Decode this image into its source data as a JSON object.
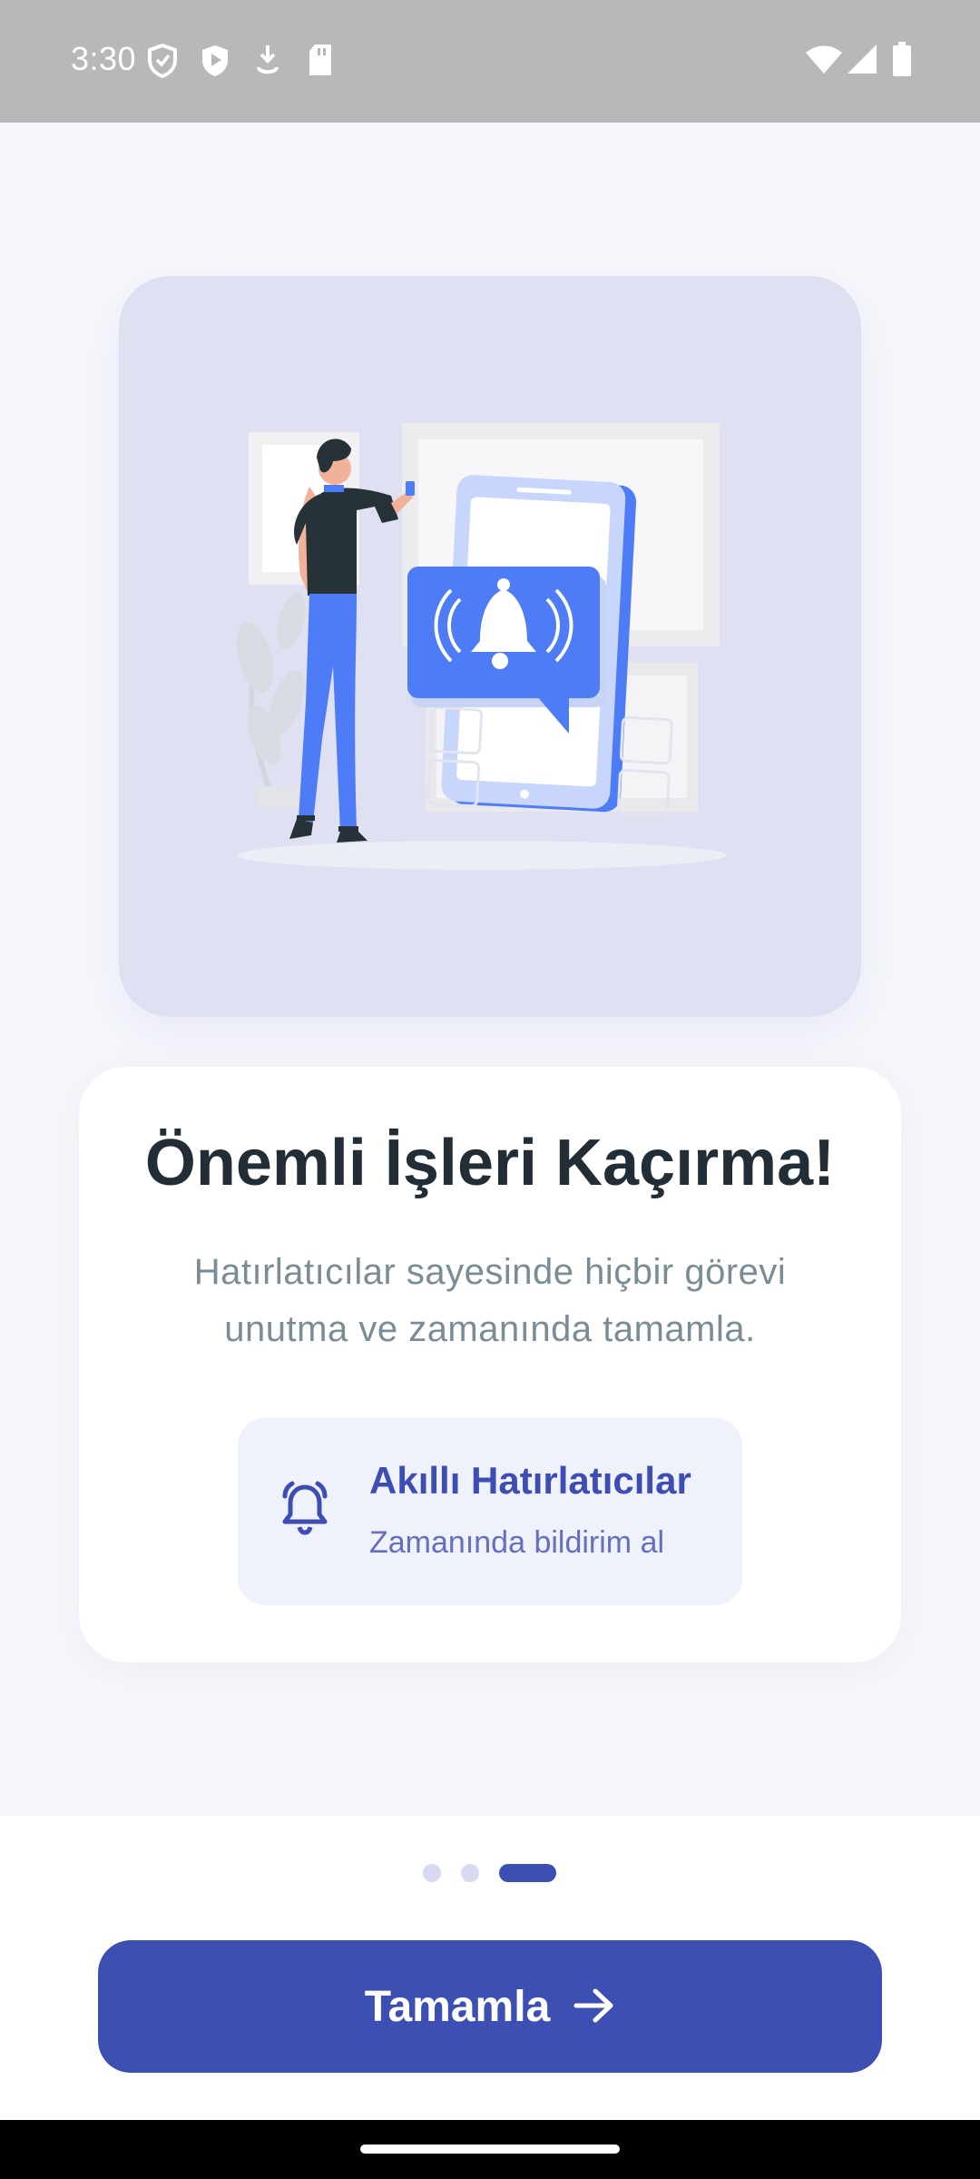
{
  "status_bar": {
    "time": "3:30",
    "left_icons": [
      "shield-icon",
      "play-shield-icon",
      "download-icon",
      "sd-card-icon"
    ],
    "right_icons": [
      "wifi-icon",
      "signal-icon",
      "battery-icon"
    ]
  },
  "illustration": {
    "description_icon": "notification-bell-illustration",
    "accent": "#4e7cf6",
    "card_bg": "#dfe1f2"
  },
  "onboarding": {
    "title": "Önemli İşleri Kaçırma!",
    "subtitle": "Hatırlatıcılar sayesinde hiçbir görevi unutma ve zamanında tamamla.",
    "feature": {
      "icon": "alarm-bell-icon",
      "title": "Akıllı Hatırlatıcılar",
      "subtitle": "Zamanında bildirim al"
    }
  },
  "pager": {
    "total": 3,
    "active_index": 2
  },
  "primary_button": {
    "label": "Tamamla",
    "icon": "arrow-right-icon",
    "color": "#3e4fb4"
  }
}
